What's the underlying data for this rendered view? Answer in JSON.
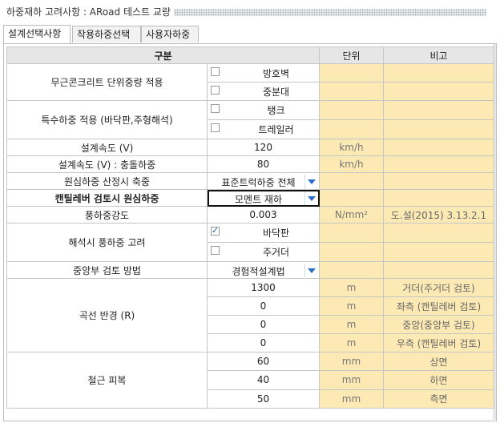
{
  "window": {
    "title": "하중재하 고려사항 : ARoad 테스트 교량"
  },
  "tabs": [
    {
      "label": "설계선택사항",
      "active": true
    },
    {
      "label": "작용하중선택",
      "active": false
    },
    {
      "label": "사용자하중",
      "active": false
    }
  ],
  "grid": {
    "headers": {
      "category": "구분",
      "unit": "단위",
      "note": "비고"
    },
    "rows": {
      "concrete_label": "무근콘크리트 단위중량 적용",
      "concrete_opt1": "방호벽",
      "concrete_opt2": "중분대",
      "special_label": "특수하중 적용 (바닥판,주형해석)",
      "special_opt1": "탱크",
      "special_opt2": "트레일러",
      "speed_label": "설계속도 (V)",
      "speed_value": "120",
      "speed_unit": "km/h",
      "impact_speed_label": "설계속도 (V) : 충돌하중",
      "impact_speed_value": "80",
      "impact_speed_unit": "km/h",
      "cf_axle_label": "원심하중 산정시 축중",
      "cf_axle_value": "표준트럭하중 전체",
      "cantilever_label": "캔틸레버 검토시 원심하중",
      "cantilever_value": "모멘트 재하",
      "wind_label": "풍하중강도",
      "wind_value": "0.003",
      "wind_unit": "N/mm²",
      "wind_note": "도.설(2015) 3.13.2.1",
      "wind_analysis_label": "해석시 풍하중 고려",
      "wind_opt1": "바닥판",
      "wind_opt2": "주거더",
      "center_label": "중앙부 검토 방법",
      "center_value": "경험적설계법",
      "radius_label": "곡선 반경 (R)",
      "radius_values": [
        "1300",
        "0",
        "0",
        "0"
      ],
      "radius_unit": "m",
      "radius_notes": [
        "거더(주거더 검토)",
        "좌측 (캔틸레버 검토)",
        "중앙(중앙부 검토)",
        "우측 (캔틸레버 검토)"
      ],
      "cover_label": "철근 피복",
      "cover_values": [
        "60",
        "40",
        "50"
      ],
      "cover_unit": "mm",
      "cover_notes": [
        "상면",
        "하면",
        "측면"
      ]
    }
  },
  "checkbox_states": {
    "concrete_opt1": false,
    "concrete_opt2": false,
    "special_opt1": false,
    "special_opt2": false,
    "wind_opt1": true,
    "wind_opt2": false
  },
  "colors": {
    "accent": "#2b6cc4",
    "yellow_cell": "#fde9b4",
    "header_bg": "#e6e6e6"
  }
}
